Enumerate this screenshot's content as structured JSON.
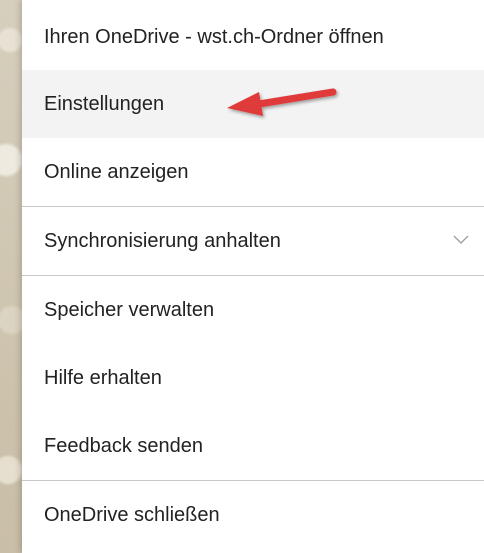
{
  "menu": {
    "items": [
      {
        "label": "Ihren OneDrive - wst.ch-Ordner öffnen"
      },
      {
        "label": "Einstellungen"
      },
      {
        "label": "Online anzeigen"
      },
      {
        "label": "Synchronisierung anhalten",
        "icon": "chevron-down-icon"
      },
      {
        "label": "Speicher verwalten"
      },
      {
        "label": "Hilfe erhalten"
      },
      {
        "label": "Feedback senden"
      },
      {
        "label": "OneDrive schließen"
      }
    ]
  },
  "annotation": {
    "arrow_icon": "red-arrow-icon",
    "arrow_color": "#e03a3a"
  },
  "colors": {
    "menu_background": "#ffffff",
    "highlight_background": "#f3f3f3",
    "divider": "#c8c8c8",
    "text": "#222222"
  }
}
